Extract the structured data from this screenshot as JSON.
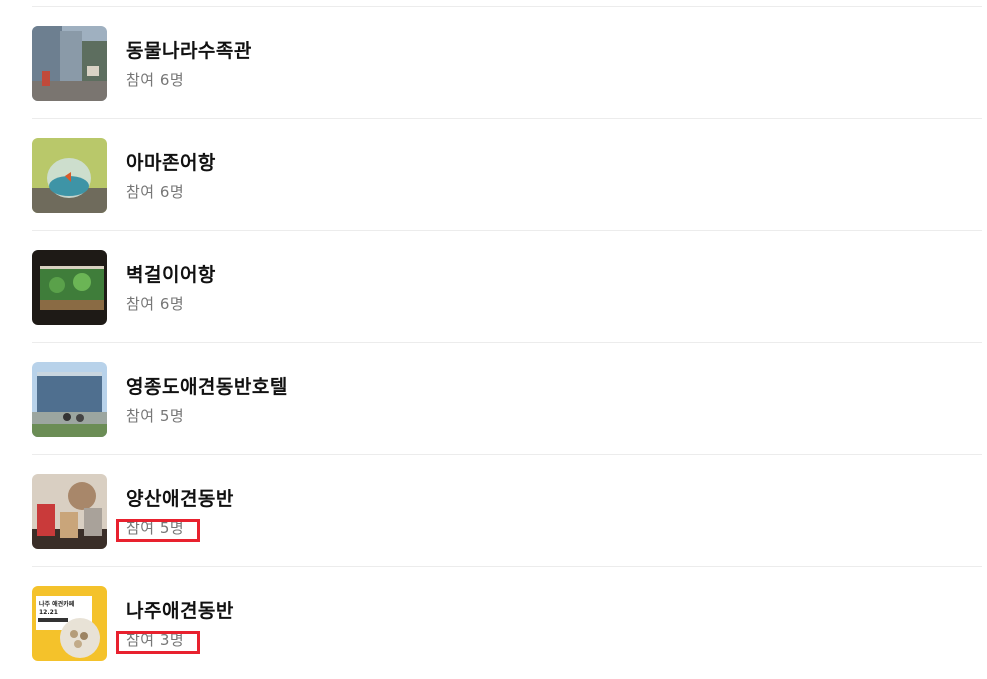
{
  "items": [
    {
      "name": "동물나라수족관",
      "participants": "참여 6명",
      "thumbnail": "street-photo",
      "highlighted": false
    },
    {
      "name": "아마존어항",
      "participants": "참여 6명",
      "thumbnail": "fishbowl-photo",
      "highlighted": false
    },
    {
      "name": "벽걸이어항",
      "participants": "참여 6명",
      "thumbnail": "aquarium-photo",
      "highlighted": false
    },
    {
      "name": "영종도애견동반호텔",
      "participants": "참여 5명",
      "thumbnail": "hotel-photo",
      "highlighted": false
    },
    {
      "name": "양산애견동반",
      "participants": "참여 5명",
      "thumbnail": "cafe-photo",
      "highlighted": true
    },
    {
      "name": "나주애견동반",
      "participants": "참여 3명",
      "thumbnail": "poster-photo",
      "highlighted": true
    }
  ],
  "poster_text": {
    "line1": "나주 애견카페",
    "line2": "12.21"
  },
  "colors": {
    "highlight": "#e8212e",
    "divider": "#ececec",
    "subtext": "#777777",
    "poster_bg": "#f4c22b"
  }
}
